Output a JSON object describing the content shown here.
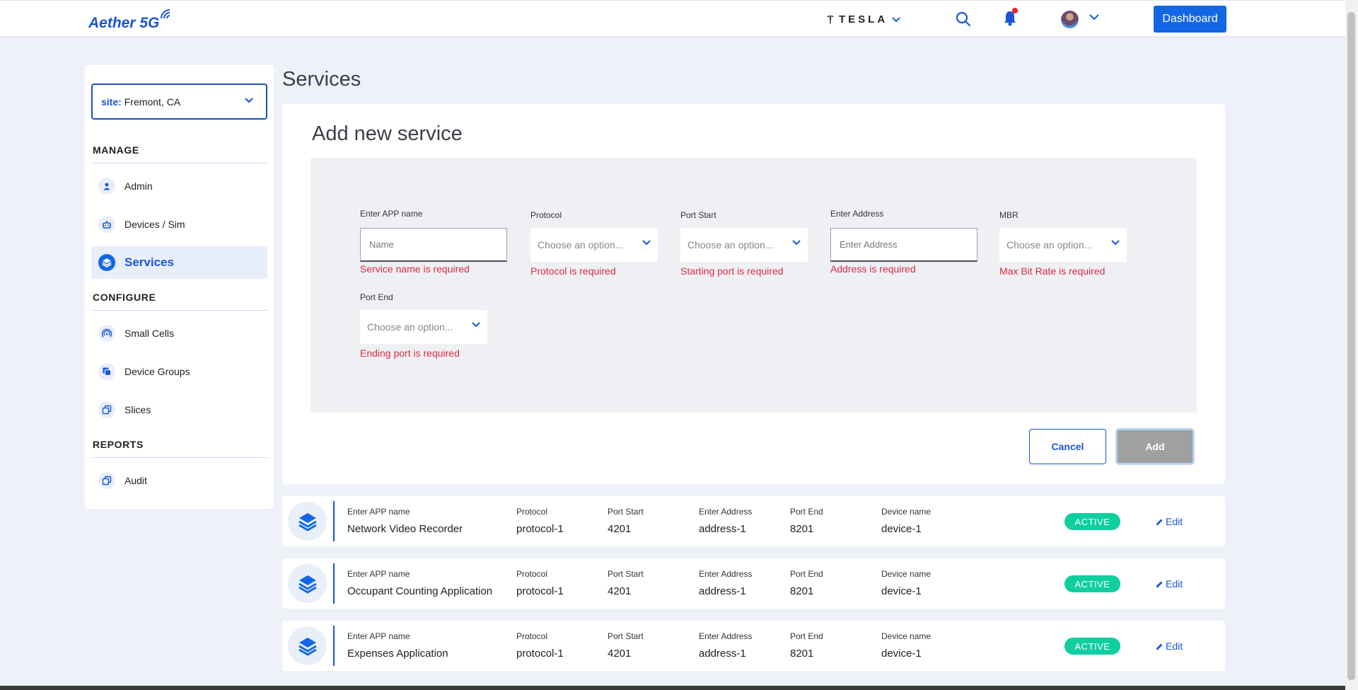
{
  "app": {
    "logo_text": "Aether 5G"
  },
  "header": {
    "tenant_name": "TESLA",
    "dashboard_label": "Dashboard"
  },
  "sidebar": {
    "site_label": "site:",
    "site_value": "Fremont, CA",
    "sections": {
      "manage": "MANAGE",
      "configure": "CONFIGURE",
      "reports": "REPORTS"
    },
    "items": [
      {
        "label": "Admin",
        "icon": "user-icon"
      },
      {
        "label": "Devices / Sim",
        "icon": "robot-icon"
      },
      {
        "label": "Services",
        "icon": "layers-icon",
        "active": true
      },
      {
        "label": "Small Cells",
        "icon": "signal-icon"
      },
      {
        "label": "Device Groups",
        "icon": "copy-icon"
      },
      {
        "label": "Slices",
        "icon": "slices-icon"
      },
      {
        "label": "Audit",
        "icon": "audit-icon"
      }
    ]
  },
  "page": {
    "title": "Services"
  },
  "form": {
    "heading": "Add new service",
    "app_name": {
      "label": "Enter APP name",
      "placeholder": "Name",
      "error": "Service name is required"
    },
    "protocol": {
      "label": "Protocol",
      "placeholder": "Choose an option...",
      "error": "Protocol is required"
    },
    "port_start": {
      "label": "Port Start",
      "placeholder": "Choose an option...",
      "error": "Starting port is required"
    },
    "address": {
      "label": "Enter Address",
      "placeholder": "Enter Address",
      "error": "Address is required"
    },
    "mbr": {
      "label": "MBR",
      "placeholder": "Choose an option...",
      "error": "Max Bit Rate is required"
    },
    "port_end": {
      "label": "Port End",
      "placeholder": "Choose an option...",
      "error": "Ending port is required"
    },
    "cancel_label": "Cancel",
    "add_label": "Add"
  },
  "services": {
    "column_labels": {
      "app_name": "Enter APP name",
      "protocol": "Protocol",
      "port_start": "Port Start",
      "address": "Enter Address",
      "port_end": "Port End",
      "device": "Device name"
    },
    "edit_label": "Edit",
    "rows": [
      {
        "app_name": "Network Video Recorder",
        "protocol": "protocol-1",
        "port_start": "4201",
        "address": "address-1",
        "port_end": "8201",
        "device": "device-1",
        "status": "ACTIVE"
      },
      {
        "app_name": "Occupant Counting Application",
        "protocol": "protocol-1",
        "port_start": "4201",
        "address": "address-1",
        "port_end": "8201",
        "device": "device-1",
        "status": "ACTIVE"
      },
      {
        "app_name": "Expenses Application",
        "protocol": "protocol-1",
        "port_start": "4201",
        "address": "address-1",
        "port_end": "8201",
        "device": "device-1",
        "status": "ACTIVE"
      }
    ]
  },
  "colors": {
    "primary": "#1467e4",
    "error": "#dd2b3f",
    "active_badge": "#0fcfa0",
    "background": "#eef1f7"
  }
}
